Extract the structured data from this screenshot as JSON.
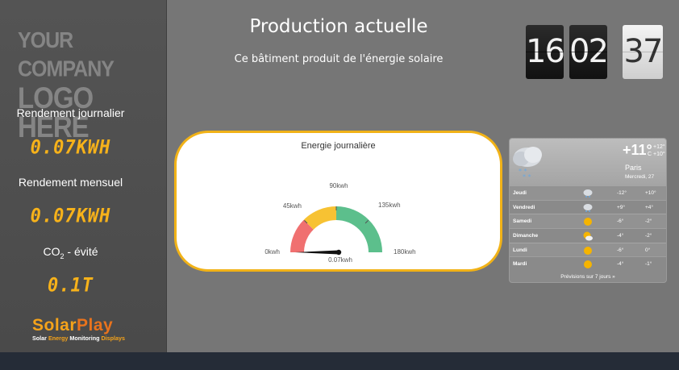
{
  "sidebar": {
    "logo_line1": "YOUR COMPANY",
    "logo_line2": "LOGO HERE",
    "daily_label": "Rendement journalier",
    "daily_value": "0.07KWH",
    "monthly_label": "Rendement mensuel",
    "monthly_value": "0.07KWH",
    "co2_prefix": "CO",
    "co2_sub": "2",
    "co2_suffix": " - évité",
    "co2_value": "0.1T",
    "brand_part1": "Solar",
    "brand_part2": "Play",
    "tagline_a": "Solar ",
    "tagline_b": "Energy",
    "tagline_c": " Monitoring ",
    "tagline_d": "Displays"
  },
  "header": {
    "title": "Production actuelle",
    "subtitle": "Ce bâtiment produit de l'énergie solaire"
  },
  "clock": {
    "h": "16",
    "m": "02",
    "s": "37"
  },
  "gauge": {
    "title": "Energie journalière",
    "min_label": "0kwh",
    "t1_label": "45kwh",
    "t2_label": "90kwh",
    "t3_label": "135kwh",
    "max_label": "180kwh",
    "value_label": "0.07kwh",
    "value": 0.07,
    "max": 180,
    "colors": {
      "red": "#f07070",
      "yellow": "#f7c233",
      "green": "#5cbf8c"
    }
  },
  "weather": {
    "temp": "+11°",
    "unit": "C",
    "high": "+12°",
    "low": "+10°",
    "city": "Paris",
    "date": "Mercredi, 27",
    "footer": "Prévisions sur 7 jours »",
    "days": [
      {
        "day": "Jeudi",
        "icon": "snow-cloud-icon",
        "lo": "-12°",
        "hi": "+10°"
      },
      {
        "day": "Vendredi",
        "icon": "snow-cloud-icon",
        "lo": "+9°",
        "hi": "+4°"
      },
      {
        "day": "Samedi",
        "icon": "sun-icon",
        "lo": "-6°",
        "hi": "-2°"
      },
      {
        "day": "Dimanche",
        "icon": "sun-cloud-icon",
        "lo": "-4°",
        "hi": "-2°"
      },
      {
        "day": "Lundi",
        "icon": "sun-icon",
        "lo": "-6°",
        "hi": "0°"
      },
      {
        "day": "Mardi",
        "icon": "sun-icon",
        "lo": "-4°",
        "hi": "-1°"
      }
    ]
  }
}
